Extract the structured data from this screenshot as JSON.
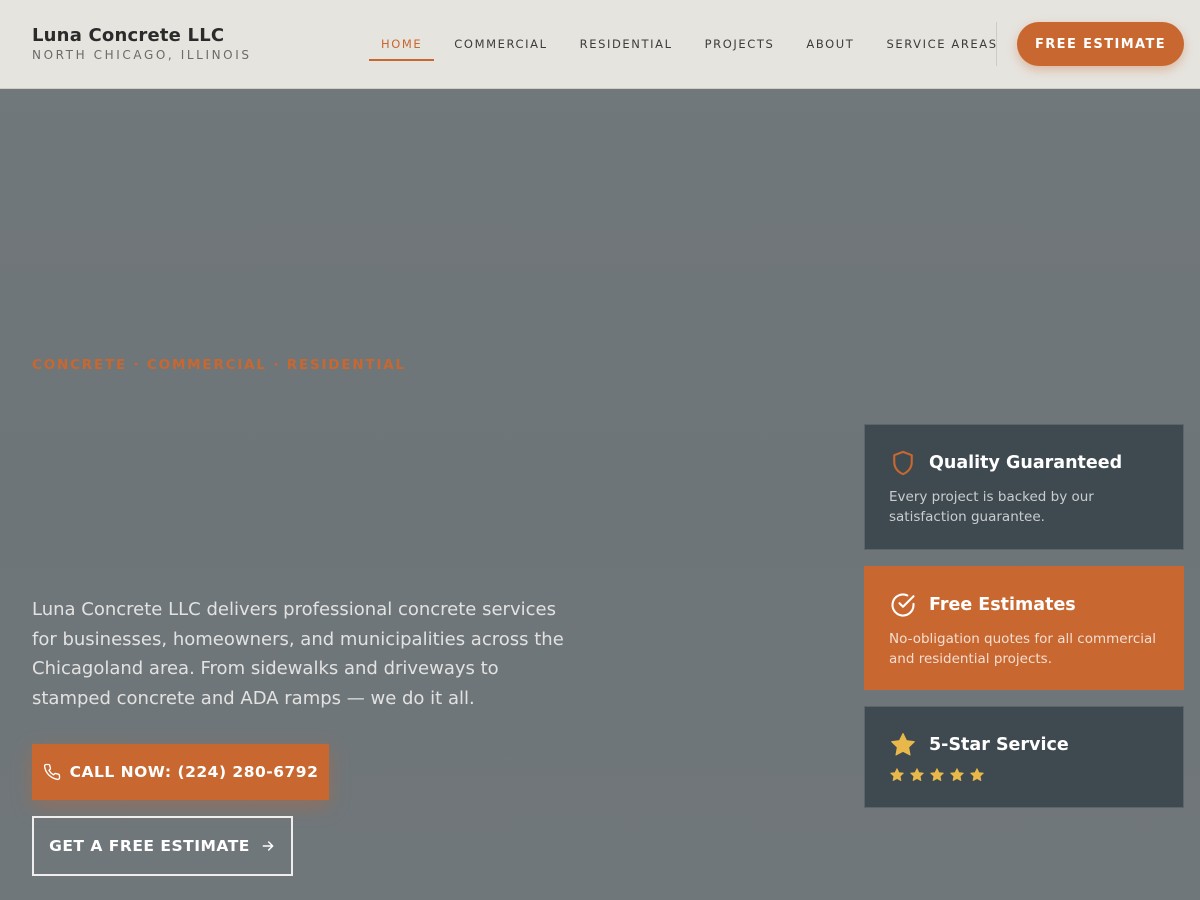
{
  "brand": {
    "name": "Luna Concrete LLC",
    "location": "NORTH CHICAGO, ILLINOIS"
  },
  "nav": {
    "items": [
      "HOME",
      "COMMERCIAL",
      "RESIDENTIAL",
      "PROJECTS",
      "ABOUT",
      "SERVICE AREAS"
    ],
    "active": "HOME"
  },
  "header_cta": {
    "label": "FREE ESTIMATE"
  },
  "hero": {
    "tagline": "CONCRETE · COMMERCIAL · RESIDENTIAL",
    "description": "Luna Concrete LLC delivers professional concrete services for businesses, homeowners, and municipalities across the Chicagoland area. From sidewalks and driveways to stamped concrete and ADA ramps — we do it all.",
    "call_button": "CALL NOW: (224) 280-6792",
    "estimate_button": "GET A FREE ESTIMATE"
  },
  "cards": [
    {
      "icon": "shield-icon",
      "title": "Quality Guaranteed",
      "text": "Every project is backed by our satisfaction guarantee."
    },
    {
      "icon": "check-circle-icon",
      "title": "Free Estimates",
      "text": "No-obligation quotes for all commercial and residential projects."
    },
    {
      "icon": "star-icon",
      "title": "5-Star Service",
      "rating": 5
    }
  ],
  "colors": {
    "accent": "#c8672f",
    "header_bg": "#e6e4df",
    "card_dark": "#3f4a50",
    "star": "#e9b84a"
  }
}
